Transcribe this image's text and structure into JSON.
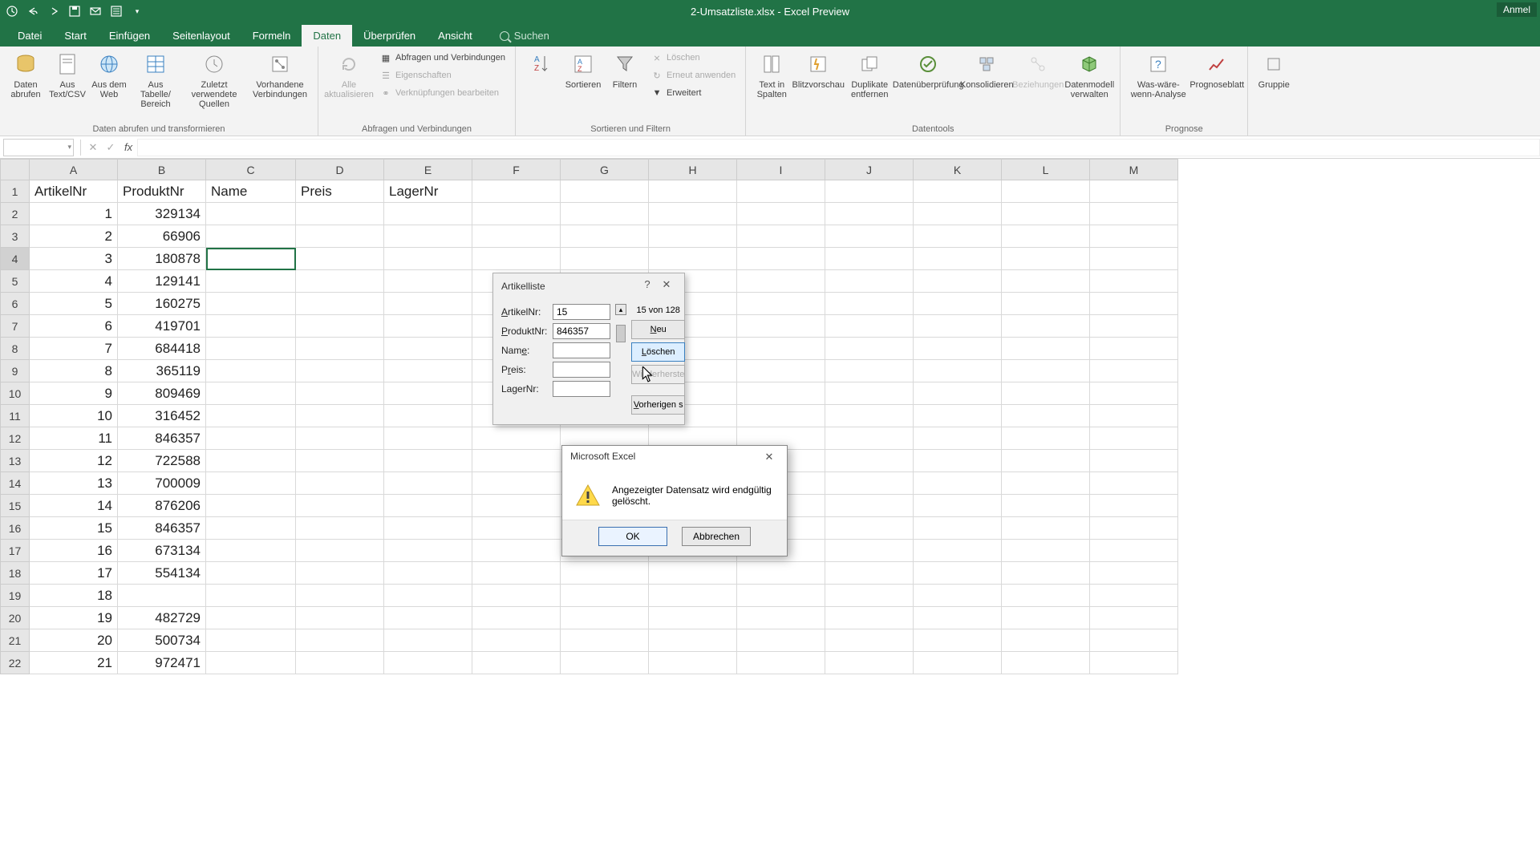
{
  "titlebar": {
    "title": "2-Umsatzliste.xlsx - Excel Preview",
    "signin": "Anmel"
  },
  "tabs": {
    "items": [
      "Datei",
      "Start",
      "Einfügen",
      "Seitenlayout",
      "Formeln",
      "Daten",
      "Überprüfen",
      "Ansicht"
    ],
    "active": 5,
    "search": "Suchen"
  },
  "ribbon": {
    "g1": {
      "label": "Daten abrufen und transformieren",
      "b": [
        "Daten abrufen",
        "Aus Text/CSV",
        "Aus dem Web",
        "Aus Tabelle/ Bereich",
        "Zuletzt verwendete Quellen",
        "Vorhandene Verbindungen"
      ]
    },
    "g2": {
      "label": "Abfragen und Verbindungen",
      "refresh": "Alle aktualisieren",
      "s": [
        "Abfragen und Verbindungen",
        "Eigenschaften",
        "Verknüpfungen bearbeiten"
      ]
    },
    "g3": {
      "label": "Sortieren und Filtern",
      "sort": "Sortieren",
      "filter": "Filtern",
      "s": [
        "Löschen",
        "Erneut anwenden",
        "Erweitert"
      ]
    },
    "g4": {
      "label": "Datentools",
      "b": [
        "Text in Spalten",
        "Blitzvorschau",
        "Duplikate entfernen",
        "Datenüberprüfung",
        "Konsolidieren",
        "Beziehungen",
        "Datenmodell verwalten"
      ]
    },
    "g5": {
      "label": "Prognose",
      "b": [
        "Was-wäre-wenn-Analyse",
        "Prognoseblatt"
      ]
    },
    "g6": {
      "b": "Gruppie"
    }
  },
  "sheet": {
    "cols": [
      "A",
      "B",
      "C",
      "D",
      "E",
      "F",
      "G",
      "H",
      "I",
      "J",
      "K",
      "L",
      "M"
    ],
    "headers": [
      "ArtikelNr",
      "ProduktNr",
      "Name",
      "Preis",
      "LagerNr"
    ],
    "rows": [
      {
        "n": 1,
        "a": 1,
        "b": 329134
      },
      {
        "n": 2,
        "a": 2,
        "b": 66906
      },
      {
        "n": 3,
        "a": 3,
        "b": 180878
      },
      {
        "n": 4,
        "a": 4,
        "b": 129141
      },
      {
        "n": 5,
        "a": 5,
        "b": 160275
      },
      {
        "n": 6,
        "a": 6,
        "b": 419701
      },
      {
        "n": 7,
        "a": 7,
        "b": 684418
      },
      {
        "n": 8,
        "a": 8,
        "b": 365119
      },
      {
        "n": 9,
        "a": 9,
        "b": 809469
      },
      {
        "n": 10,
        "a": 10,
        "b": 316452
      },
      {
        "n": 11,
        "a": 11,
        "b": 846357
      },
      {
        "n": 12,
        "a": 12,
        "b": 722588
      },
      {
        "n": 13,
        "a": 13,
        "b": 700009
      },
      {
        "n": 14,
        "a": 14,
        "b": 876206
      },
      {
        "n": 15,
        "a": 15,
        "b": 846357
      },
      {
        "n": 16,
        "a": 16,
        "b": 673134
      },
      {
        "n": 17,
        "a": 17,
        "b": 554134
      },
      {
        "n": 18,
        "a": 18,
        "b": ""
      },
      {
        "n": 19,
        "a": 19,
        "b": 482729
      },
      {
        "n": 20,
        "a": 20,
        "b": 500734
      },
      {
        "n": 21,
        "a": 21,
        "b": 972471
      }
    ],
    "selected_row": 3
  },
  "formdlg": {
    "title": "Artikelliste",
    "record_info": "15 von 128",
    "fields": {
      "artikelnr": {
        "label": "ArtikelNr:",
        "value": "15"
      },
      "produktnr": {
        "label": "ProduktNr:",
        "value": "846357"
      },
      "name": {
        "label": "Name:",
        "value": ""
      },
      "preis": {
        "label": "Preis:",
        "value": ""
      },
      "lagernr": {
        "label": "LagerNr:",
        "value": ""
      }
    },
    "buttons": {
      "neu": "Neu",
      "loeschen": "Löschen",
      "wieder": "Wiederherste",
      "vorher": "Vorherigen s"
    }
  },
  "msgbox": {
    "title": "Microsoft Excel",
    "text": "Angezeigter Datensatz wird endgültig gelöscht.",
    "ok": "OK",
    "cancel": "Abbrechen"
  }
}
